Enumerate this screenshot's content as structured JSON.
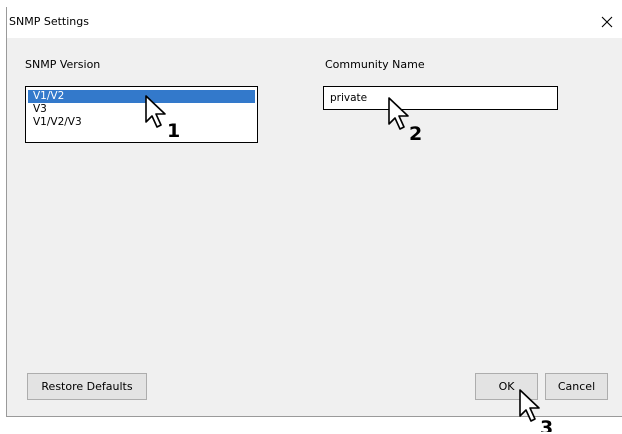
{
  "window": {
    "title": "SNMP Settings",
    "close_glyph": "✕"
  },
  "snmp_version": {
    "label": "SNMP Version",
    "options": [
      "V1/V2",
      "V3",
      "V1/V2/V3"
    ],
    "selected": "V1/V2"
  },
  "community_name": {
    "label": "Community Name",
    "value": "private"
  },
  "buttons": {
    "restore_defaults": "Restore Defaults",
    "ok": "OK",
    "cancel": "Cancel"
  },
  "callouts": [
    {
      "icon": "cursor-arrow-icon",
      "number": "1"
    },
    {
      "icon": "cursor-arrow-icon",
      "number": "2"
    },
    {
      "icon": "cursor-arrow-icon",
      "number": "3"
    }
  ],
  "colors": {
    "selection": "#3379cb",
    "dialog_background": "#f0f0f0",
    "button_background": "#e3e3e3"
  }
}
